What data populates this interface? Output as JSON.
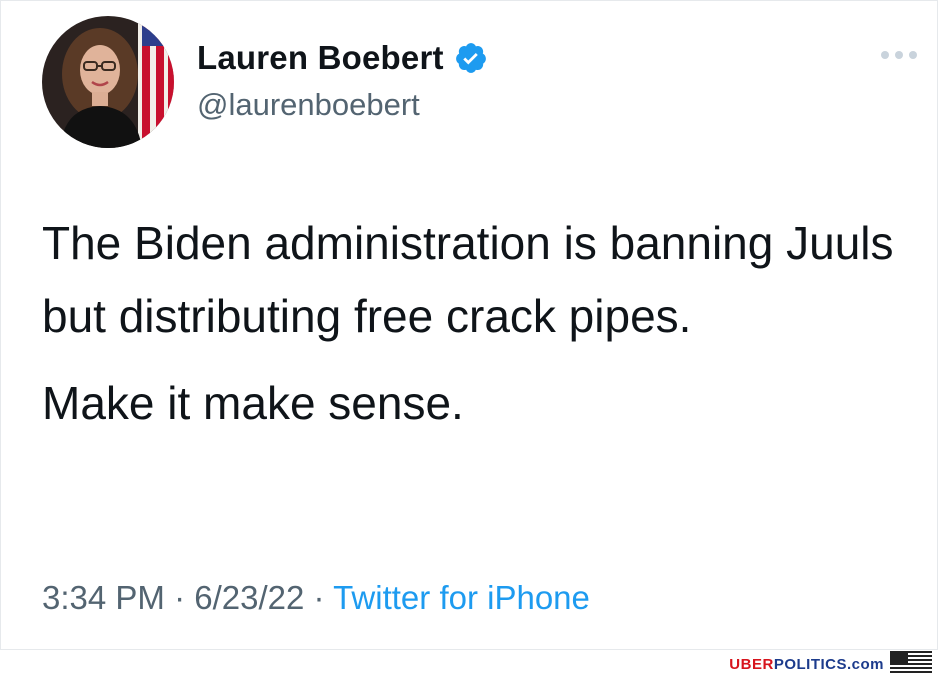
{
  "tweet": {
    "display_name": "Lauren Boebert",
    "handle": "@laurenboebert",
    "text_paragraph_1": "The Biden administration is banning Juuls but distributing free crack pipes.",
    "text_paragraph_2": "Make it make sense.",
    "time": "3:34 PM",
    "date": "6/23/22",
    "separator": "·",
    "source": "Twitter for iPhone",
    "verified_icon": "verified-badge-icon",
    "more_icon": "more-options-icon"
  },
  "watermark": {
    "part_red": "UBER",
    "part_blue": "POLITICS.com",
    "flag_icon": "us-flag-icon"
  },
  "colors": {
    "text_primary": "#0f1419",
    "text_secondary": "#536471",
    "link": "#1d9bf0",
    "verified": "#1d9bf0",
    "watermark_red": "#d7141d",
    "watermark_blue": "#1c3b8c"
  }
}
